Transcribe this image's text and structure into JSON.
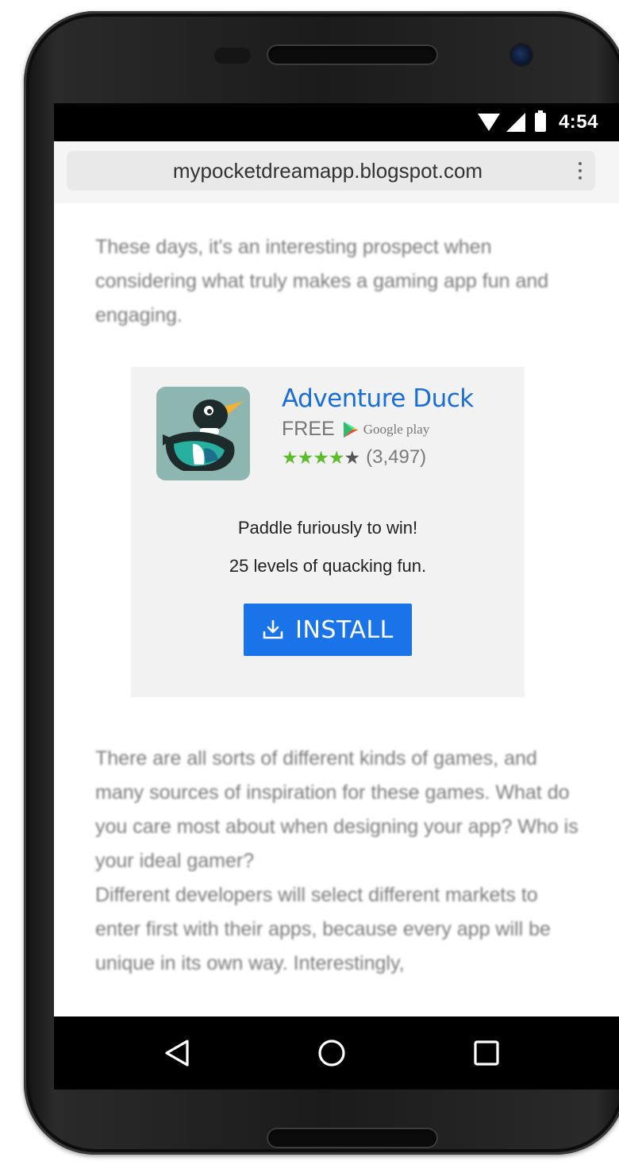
{
  "status_bar": {
    "time": "4:54",
    "icons": [
      "wifi-icon",
      "signal-icon",
      "battery-icon"
    ]
  },
  "browser": {
    "url": "mypocketdreamapp.blogspot.com",
    "menu_icon": "overflow-menu-icon"
  },
  "article": {
    "paragraph_1": "These days, it's an interesting prospect when considering what truly makes a gaming app fun and engaging.",
    "paragraph_2": "There are all sorts of different kinds of games, and many sources of inspiration for these games. What do you care most about when designing your app? Who is your ideal gamer?",
    "paragraph_3": "Different developers will select different markets to enter first with their apps, because every app will be unique in its own way. Interestingly,"
  },
  "ad": {
    "app_name": "Adventure Duck",
    "price": "FREE",
    "store_label": "Google play",
    "rating_stars": 4.5,
    "stars_glyph": "★★★★",
    "half_star_glyph": "★",
    "rating_count": "(3,497)",
    "tagline": "Paddle furiously to win!",
    "subline": "25 levels of quacking fun.",
    "install_label": "INSTALL",
    "colors": {
      "title": "#1a6ed8",
      "button": "#1a73e8",
      "stars": "#5dbb2e",
      "card_bg": "#f2f2f2"
    }
  },
  "nav_bar": {
    "icons": [
      "back-icon",
      "home-icon",
      "recents-icon"
    ]
  }
}
